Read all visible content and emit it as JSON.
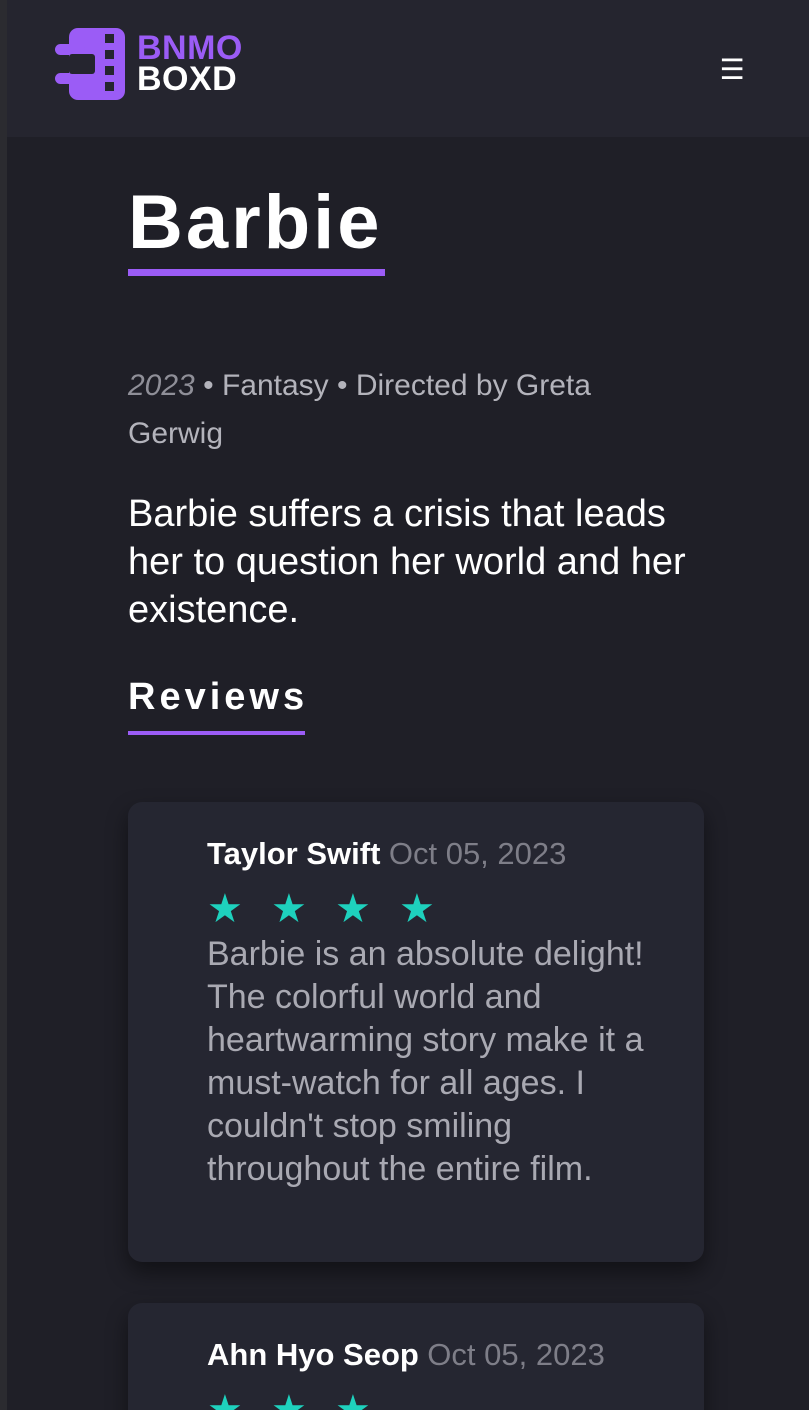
{
  "header": {
    "logo_line1": "BNMO",
    "logo_line2": "BOXD",
    "menu_icon": "☰"
  },
  "movie": {
    "title": "Barbie",
    "year": "2023",
    "genre": "Fantasy",
    "director_label": "Directed by Greta Gerwig",
    "separator": " • ",
    "synopsis": "Barbie suffers a crisis that leads her to question her world and her existence."
  },
  "reviews_section": {
    "heading": "Reviews",
    "items": [
      {
        "author": "Taylor Swift",
        "date": "Oct 05, 2023",
        "rating": 4,
        "stars": "★★★★",
        "text": "Barbie is an absolute delight! The colorful world and heartwarming story make it a must-watch for all ages. I couldn't stop smiling throughout the entire film."
      },
      {
        "author": "Ahn Hyo Seop",
        "date": "Oct 05, 2023",
        "rating": 3,
        "stars": "★★★",
        "text": ""
      }
    ]
  },
  "colors": {
    "accent": "#9b5cf6",
    "star": "#1ed1bd",
    "background": "#1f1f27",
    "navbar": "#25252f",
    "card": "#252631"
  },
  "icons": {
    "logo": "film-logo-icon",
    "menu": "hamburger-menu-icon",
    "star": "star-icon"
  }
}
